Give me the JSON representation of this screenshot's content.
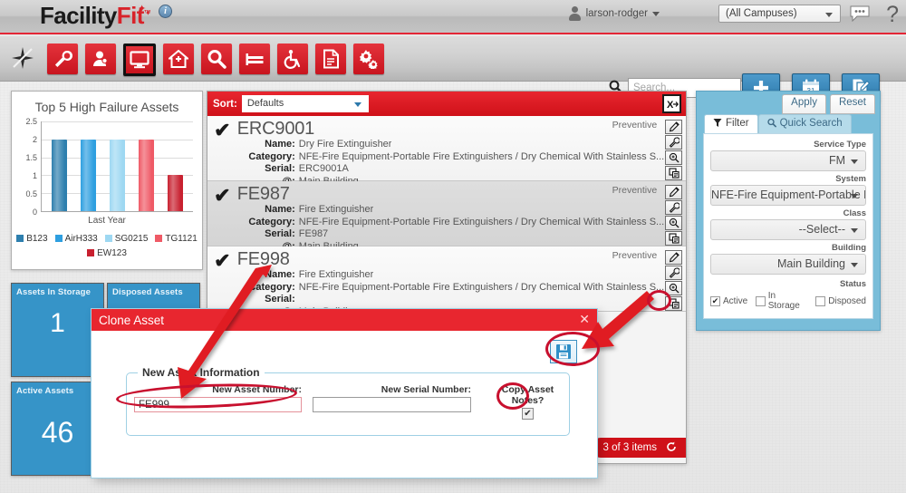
{
  "header": {
    "logo_text_1": "Facility",
    "logo_text_2": "Fit",
    "logo_tm": "™",
    "info_icon": "info-icon",
    "user_name": "larson-rodger",
    "campus_selected": "(All Campuses)",
    "chat_icon": "chat-icon",
    "help_icon": "?"
  },
  "toolbar": {
    "sparkle_icon": "sparkle-icon",
    "icons": [
      {
        "name": "wrench-icon",
        "label": "Maintenance"
      },
      {
        "name": "person-icon",
        "label": "Personnel"
      },
      {
        "name": "monitor-icon",
        "label": "Assets",
        "active": true
      },
      {
        "name": "home-plus-icon",
        "label": "Facilities"
      },
      {
        "name": "magnifier-icon",
        "label": "Search"
      },
      {
        "name": "bed-icon",
        "label": "Beds"
      },
      {
        "name": "wheelchair-icon",
        "label": "Accessibility"
      },
      {
        "name": "document-icon",
        "label": "Documents"
      },
      {
        "name": "gears-icon",
        "label": "Settings"
      }
    ],
    "search_placeholder": "Search...",
    "search_value": "",
    "add_button": "add-button",
    "calendar_button": "calendar-button",
    "document_button": "document-button",
    "calendar_day": "31"
  },
  "chart_data": {
    "type": "bar",
    "title": "Top 5 High Failure Assets",
    "categories": [
      "B123",
      "AirH333",
      "SG0215",
      "TG1121",
      "EW123"
    ],
    "values": [
      2,
      2,
      2,
      2,
      1
    ],
    "xlabel": "Last Year",
    "ylabel": "",
    "ylim": [
      0,
      2.5
    ],
    "yticks": [
      "0",
      "0.5",
      "1",
      "1.5",
      "2",
      "2.5"
    ],
    "grid": true,
    "legend_position": "bottom",
    "colors": [
      "#2e7fae",
      "#2e9fe0",
      "#9ed8f2",
      "#ef5a66",
      "#c8202f"
    ]
  },
  "stats": [
    {
      "label": "Assets In Storage",
      "value": "1"
    },
    {
      "label": "Disposed Assets",
      "value": ""
    },
    {
      "label": "Active Assets",
      "value": "46"
    }
  ],
  "list": {
    "sort_label": "Sort:",
    "sort_value": "Defaults",
    "sort_options": [
      "Defaults"
    ],
    "export_icon": "export-icon",
    "footer_count": "3 of 3 items",
    "refresh_icon": "refresh-icon",
    "field_keys": {
      "name": "Name:",
      "category": "Category:",
      "serial": "Serial:",
      "location": "@:"
    },
    "row_actions": [
      "edit-icon",
      "wrench-icon",
      "inspect-icon",
      "clone-icon"
    ],
    "rows": [
      {
        "checked": "✔",
        "id": "ERC9001",
        "badge": "Preventive",
        "name": "Dry Fire Extinguisher",
        "category": "NFE-Fire Equipment-Portable Fire Extinguishers / Dry Chemical With Stainless S...",
        "serial": "ERC9001A",
        "location": "Main Building"
      },
      {
        "checked": "✔",
        "id": "FE987",
        "badge": "Preventive",
        "name": "Fire Extinguisher",
        "category": "NFE-Fire Equipment-Portable Fire Extinguishers / Dry Chemical With Stainless S...",
        "serial": "FE987",
        "location": "Main Building"
      },
      {
        "checked": "✔",
        "id": "FE998",
        "badge": "Preventive",
        "name": "Fire Extinguisher",
        "category": "NFE-Fire Equipment-Portable Fire Extinguishers / Dry Chemical With Stainless S...",
        "serial": "",
        "location": "Main Building"
      }
    ]
  },
  "filter": {
    "apply_label": "Apply",
    "reset_label": "Reset",
    "tab_filter": "Filter",
    "tab_quick_search": "Quick Search",
    "filter_icon": "funnel-icon",
    "search_icon": "magnifier-icon",
    "fields": [
      {
        "label": "Service Type",
        "value": "FM"
      },
      {
        "label": "System",
        "value": "NFE-Fire Equipment-Portable F..."
      },
      {
        "label": "Class",
        "value": "--Select--"
      },
      {
        "label": "Building",
        "value": "Main Building"
      }
    ],
    "status_label": "Status",
    "status_options": [
      {
        "label": "Active",
        "checked": true
      },
      {
        "label": "In Storage",
        "checked": false
      },
      {
        "label": "Disposed",
        "checked": false
      }
    ]
  },
  "modal": {
    "title": "Clone Asset",
    "close_icon": "close-icon",
    "save_icon": "save-icon",
    "fieldset_legend": "New Asset Information",
    "asset_number_label": "New Asset Number:",
    "asset_number_value": "FE999",
    "serial_number_label": "New Serial Number:",
    "serial_number_value": "",
    "copy_notes_label": "Copy Asset Notes?",
    "copy_notes_checked": true
  },
  "colors": {
    "brand_red": "#e8262f",
    "accent_blue": "#3694c8",
    "annotation_red": "#c8102e"
  }
}
